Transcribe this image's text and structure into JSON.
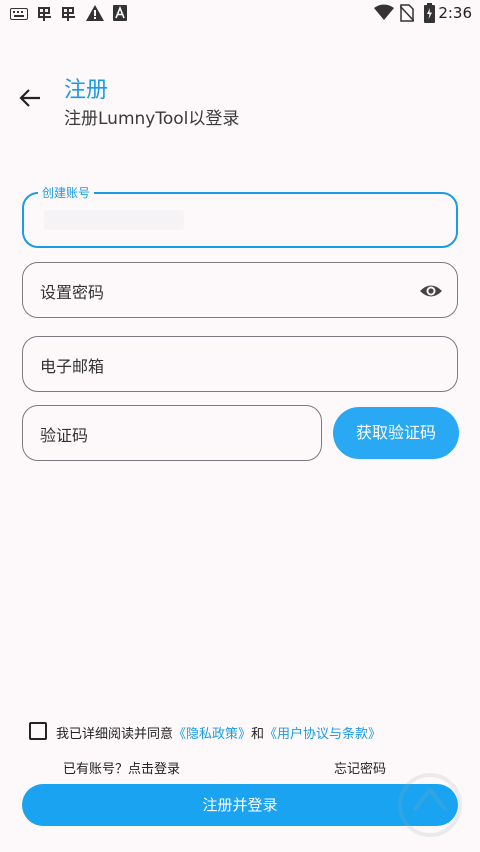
{
  "status_bar": {
    "time": "2:36",
    "left_icons": [
      "keyboard-icon",
      "app-icon",
      "app-icon",
      "warning-icon",
      "font-icon"
    ],
    "right_icons": [
      "wifi-icon",
      "no-sim-icon",
      "battery-charging-icon"
    ]
  },
  "header": {
    "back_icon": "arrow-left-icon",
    "title": "注册",
    "subtitle": "注册LumnyTool以登录"
  },
  "form": {
    "account": {
      "label": "创建账号"
    },
    "password": {
      "label": "设置密码",
      "toggle_icon": "eye-icon"
    },
    "email": {
      "label": "电子邮箱"
    },
    "code": {
      "label": "验证码"
    },
    "get_code_label": "获取验证码"
  },
  "agreement": {
    "prefix": "我已详细阅读并同意",
    "privacy_link": "《隐私政策》",
    "and": "和",
    "terms_link": "《用户协议与条款》"
  },
  "links": {
    "has_account": "已有账号？点击登录",
    "forgot_password": "忘记密码"
  },
  "submit_label": "注册并登录",
  "colors": {
    "accent": "#1a9be6",
    "button": "#1aa3f0",
    "background": "#fdf9fb"
  }
}
